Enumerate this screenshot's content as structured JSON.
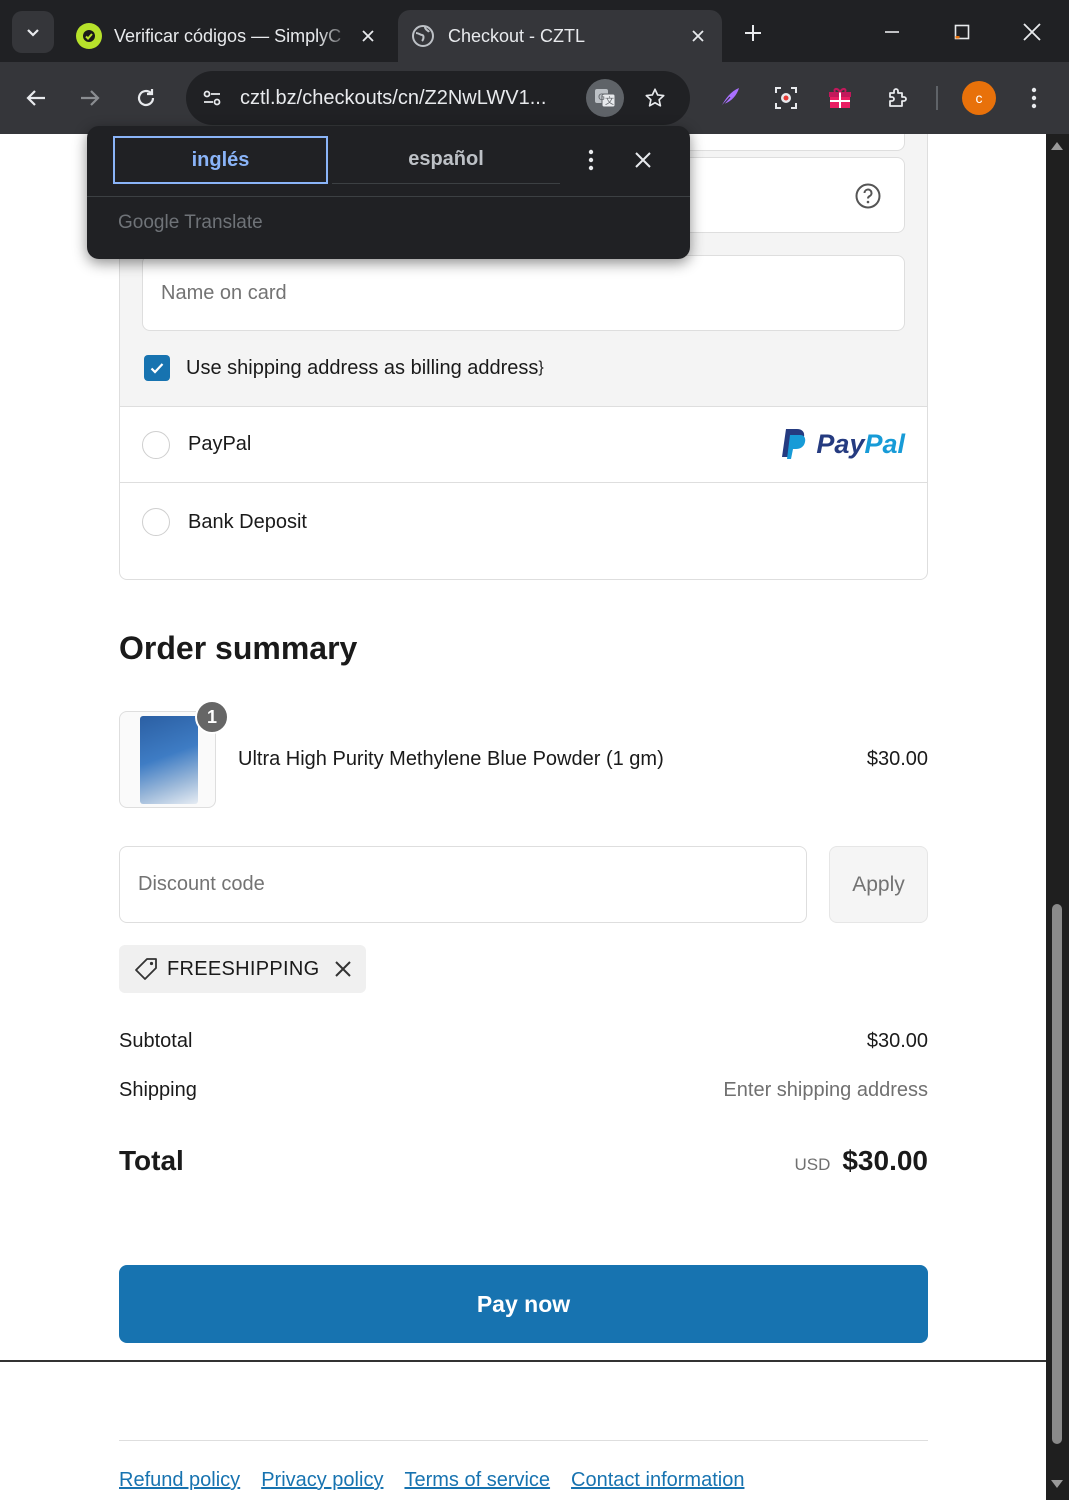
{
  "browser": {
    "tabs": [
      {
        "title": "Verificar códigos — SimplyC",
        "active": false,
        "favicon": "simplycodes-icon",
        "favicon_color": "#b7e22b"
      },
      {
        "title": "Checkout - CZTL",
        "active": true,
        "favicon": "globe-icon"
      }
    ],
    "url": "cztl.bz/checkouts/cn/Z2NwLWV1...",
    "avatar_letter": "c",
    "avatar_color": "#e8710a"
  },
  "translate_popup": {
    "source_language": "inglés",
    "target_language": "español",
    "brand": "Google Translate"
  },
  "payment": {
    "name_on_card_placeholder": "Name on card",
    "billing_checkbox_label": "Use shipping address as billing address",
    "billing_checkbox_checked": true,
    "methods": [
      {
        "label": "PayPal",
        "logo_pay": "Pay",
        "logo_pal": "Pal"
      },
      {
        "label": "Bank Deposit"
      }
    ]
  },
  "order_summary": {
    "title": "Order summary",
    "item": {
      "name": "Ultra High Purity Methylene Blue Powder (1 gm)",
      "price": "$30.00",
      "quantity": "1"
    },
    "discount_placeholder": "Discount code",
    "apply_label": "Apply",
    "applied_code": "FREESHIPPING",
    "subtotal_label": "Subtotal",
    "subtotal_value": "$30.00",
    "shipping_label": "Shipping",
    "shipping_value": "Enter shipping address",
    "total_label": "Total",
    "currency": "USD",
    "total_value": "$30.00"
  },
  "pay_button_label": "Pay now",
  "footer_links": [
    "Refund policy",
    "Privacy policy",
    "Terms of service",
    "Contact information"
  ],
  "colors": {
    "accent": "#1773b0",
    "chrome_dark": "#202124",
    "chrome_toolbar": "#35363a"
  }
}
